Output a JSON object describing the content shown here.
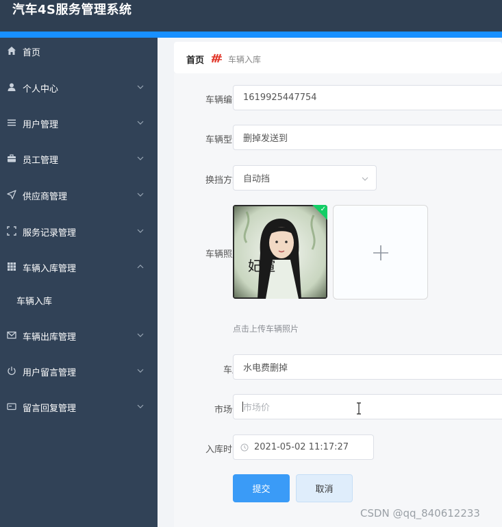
{
  "app": {
    "title": "汽车4S服务管理系统"
  },
  "sidebar": {
    "items": [
      {
        "label": "首页",
        "icon": "home-icon",
        "expandable": false
      },
      {
        "label": "个人中心",
        "icon": "user-icon",
        "expandable": true
      },
      {
        "label": "用户管理",
        "icon": "menu-lines-icon",
        "expandable": true
      },
      {
        "label": "员工管理",
        "icon": "briefcase-icon",
        "expandable": true
      },
      {
        "label": "供应商管理",
        "icon": "send-icon",
        "expandable": true
      },
      {
        "label": "服务记录管理",
        "icon": "scan-frame-icon",
        "expandable": true
      },
      {
        "label": "车辆入库管理",
        "icon": "grid-icon",
        "expandable": true,
        "expanded": true,
        "children": [
          {
            "label": "车辆入库"
          }
        ]
      },
      {
        "label": "车辆出库管理",
        "icon": "mail-icon",
        "expandable": true
      },
      {
        "label": "用户留言管理",
        "icon": "power-icon",
        "expandable": true
      },
      {
        "label": "留言回复管理",
        "icon": "card-icon",
        "expandable": true
      }
    ]
  },
  "breadcrumb": {
    "home": "首页",
    "current": "车辆入库"
  },
  "form": {
    "vehicle_no": {
      "label": "车辆编号",
      "value": "1619925447754"
    },
    "vehicle_model": {
      "label": "车辆型号",
      "value": "删掉发送到"
    },
    "gearbox": {
      "label": "换挡方式",
      "value": "自动挡"
    },
    "photo": {
      "label": "车辆照片",
      "hint": "点击上传车辆照片",
      "photo_caption": "妃暄"
    },
    "seat": {
      "label": "车座",
      "value": "水电费删掉"
    },
    "price": {
      "label": "市场价",
      "value": "",
      "placeholder": "市场价"
    },
    "stock_time": {
      "label": "入库时间",
      "value": "2021-05-02 11:17:27"
    },
    "submit_label": "提交",
    "cancel_label": "取消"
  },
  "watermark": "CSDN @qq_840612233",
  "colors": {
    "header_bg": "#2f3f52",
    "accent": "#1890ff",
    "sidebar_bg": "#314257",
    "primary_button": "#3a9bf7",
    "success": "#13ce66"
  }
}
